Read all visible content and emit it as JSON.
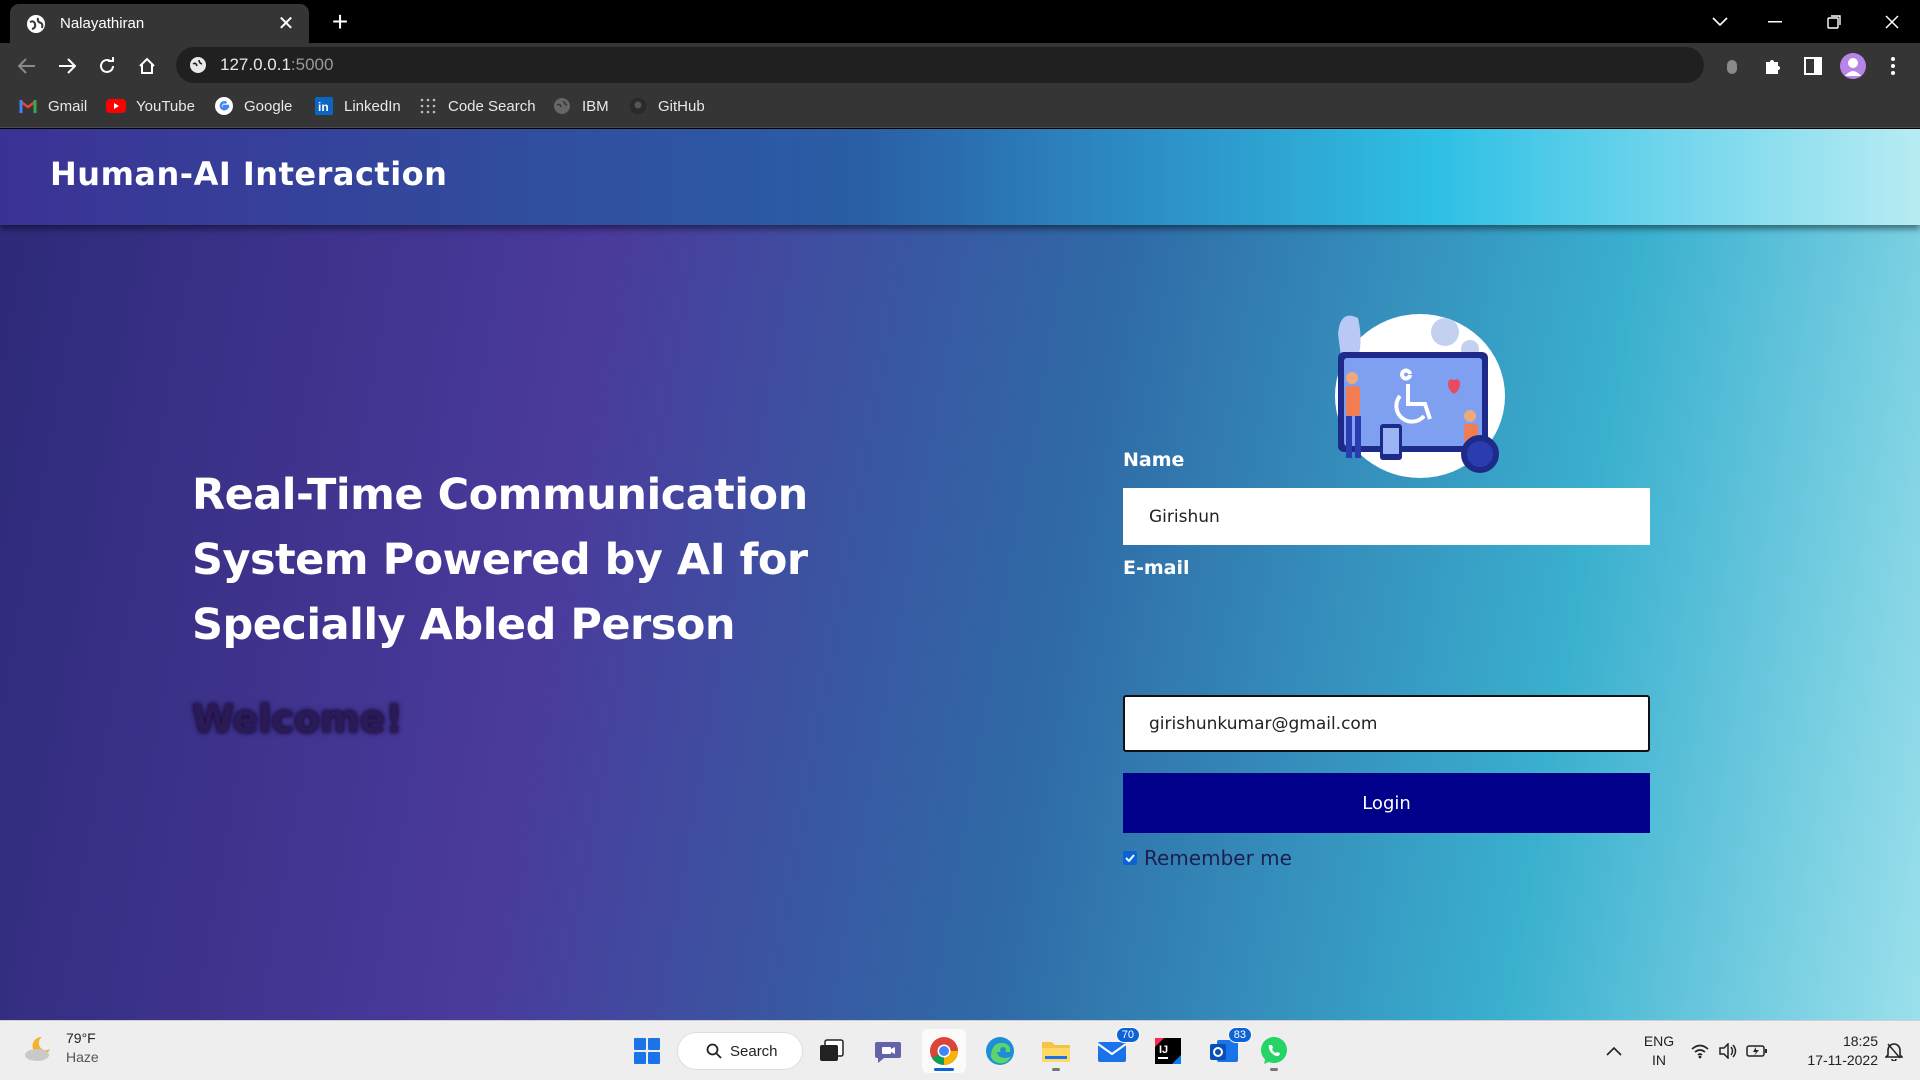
{
  "browser": {
    "tab_title": "Nalayathiran",
    "url_host": "127.0.0.1",
    "url_port": ":5000",
    "bookmarks": [
      "Gmail",
      "YouTube",
      "Google",
      "LinkedIn",
      "Code Search",
      "IBM",
      "GitHub"
    ]
  },
  "page": {
    "site_title": "Human-AI Interaction",
    "headline": "Real-Time Communication System Powered by AI for Specially Abled Person",
    "welcome": "Welcome!",
    "form": {
      "name_label": "Name",
      "name_value": "Girishun",
      "email_label": "E-mail",
      "email_value": "girishunkumar@gmail.com",
      "login_label": "Login",
      "remember_label": "Remember me",
      "remember_checked": true
    },
    "colors": {
      "login_button": "#00008b",
      "header_gradient_start": "#3b3295",
      "header_gradient_end": "#b8ecf3"
    }
  },
  "taskbar": {
    "weather_temp": "79°F",
    "weather_cond": "Haze",
    "search_label": "Search",
    "mail_badge": "70",
    "teams_badge": "83",
    "lang_top": "ENG",
    "lang_bottom": "IN",
    "time": "18:25",
    "date": "17-11-2022"
  }
}
